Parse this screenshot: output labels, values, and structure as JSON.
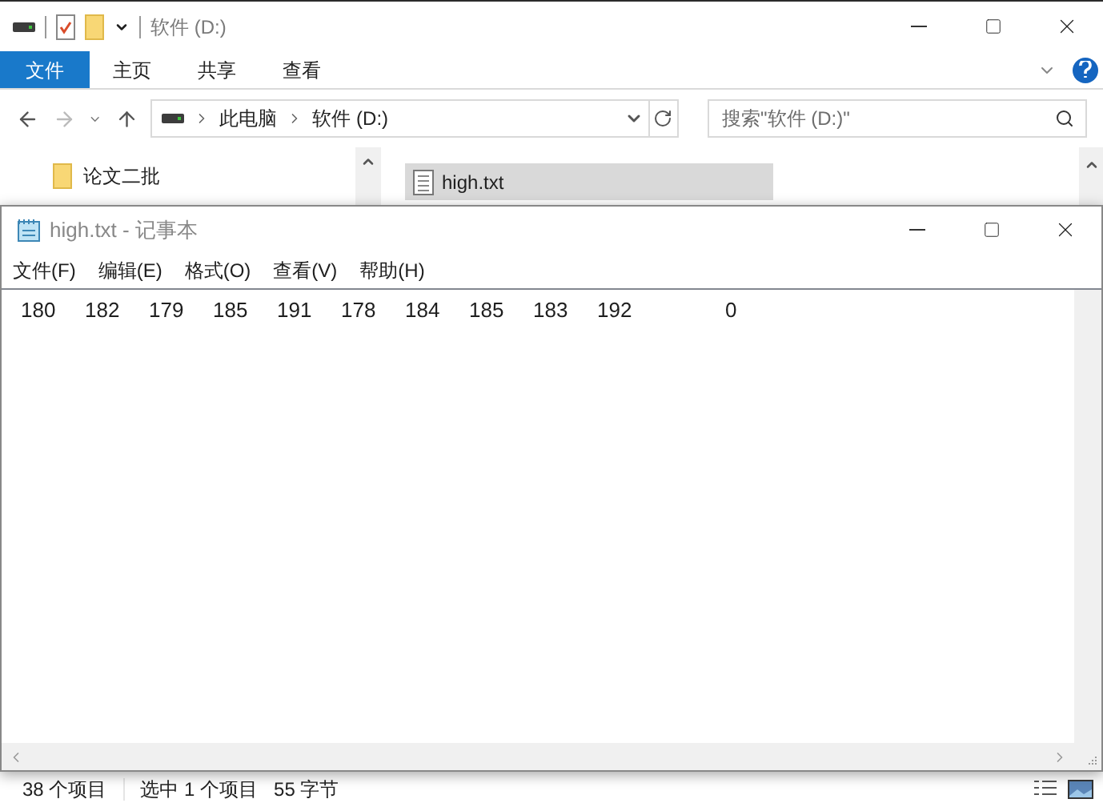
{
  "explorer": {
    "title": "软件 (D:)",
    "ribbon_tabs": [
      {
        "label": "文件",
        "selected": true
      },
      {
        "label": "主页",
        "selected": false
      },
      {
        "label": "共享",
        "selected": false
      },
      {
        "label": "查看",
        "selected": false
      }
    ],
    "breadcrumb": [
      "此电脑",
      "软件 (D:)"
    ],
    "search": {
      "placeholder": "搜索\"软件 (D:)\""
    },
    "sidebar": {
      "items": [
        {
          "label": "论文二批"
        }
      ]
    },
    "files": [
      {
        "name": "high.txt",
        "selected": true
      }
    ],
    "status_bar": {
      "item_count": "38 个项目",
      "selection": "选中 1 个项目",
      "size": "55 字节"
    }
  },
  "notepad": {
    "title": "high.txt - 记事本",
    "menu": [
      "文件(F)",
      "编辑(E)",
      "格式(O)",
      "查看(V)",
      "帮助(H)"
    ],
    "content": "180\t182\t179\t185\t191\t178\t184\t185\t183\t192\t\t0"
  }
}
